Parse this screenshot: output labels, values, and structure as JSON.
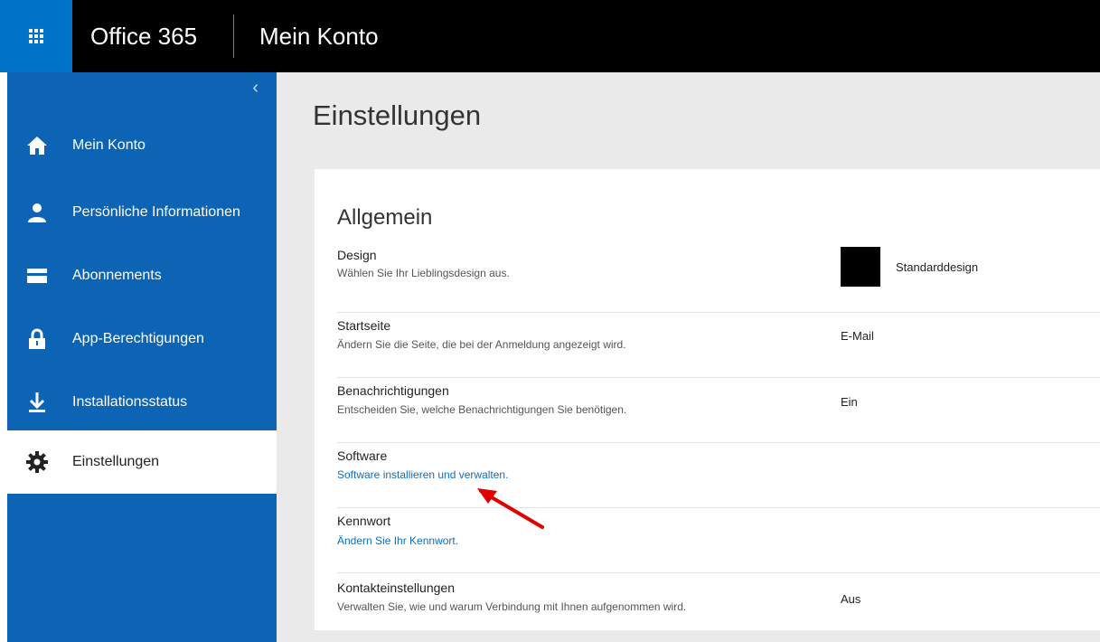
{
  "header": {
    "app_name": "Office 365",
    "page_name": "Mein Konto"
  },
  "sidebar": {
    "collapse_icon": "chevron-left-icon",
    "items": [
      {
        "label": "Mein Konto",
        "icon": "home-icon"
      },
      {
        "label": "Persönliche Informationen",
        "icon": "person-icon"
      },
      {
        "label": "Abonnements",
        "icon": "card-icon"
      },
      {
        "label": "App-Berechtigungen",
        "icon": "lock-icon"
      },
      {
        "label": "Installationsstatus",
        "icon": "download-icon"
      },
      {
        "label": "Einstellungen",
        "icon": "gear-icon",
        "active": true
      }
    ]
  },
  "main": {
    "title": "Einstellungen",
    "section_title": "Allgemein",
    "rows": [
      {
        "title": "Design",
        "desc": "Wählen Sie Ihr Lieblingsdesign aus.",
        "value": "Standarddesign"
      },
      {
        "title": "Startseite",
        "desc": "Ändern Sie die Seite, die bei der Anmeldung angezeigt wird.",
        "value": "E-Mail"
      },
      {
        "title": "Benachrichtigungen",
        "desc": "Entscheiden Sie, welche Benachrichtigungen Sie benötigen.",
        "value": "Ein"
      },
      {
        "title": "Software",
        "desc": "Software installieren und verwalten.",
        "value": ""
      },
      {
        "title": "Kennwort",
        "desc": "Ändern Sie Ihr Kennwort.",
        "value": ""
      },
      {
        "title": "Kontakteinstellungen",
        "desc": "Verwalten Sie, wie und warum Verbindung mit Ihnen aufgenommen wird.",
        "value": "Aus"
      }
    ]
  },
  "colors": {
    "brand_blue": "#0072c6",
    "sidebar_blue": "#0e64b4",
    "link_blue": "#0c6fc1",
    "annotation_red": "#e00000"
  }
}
